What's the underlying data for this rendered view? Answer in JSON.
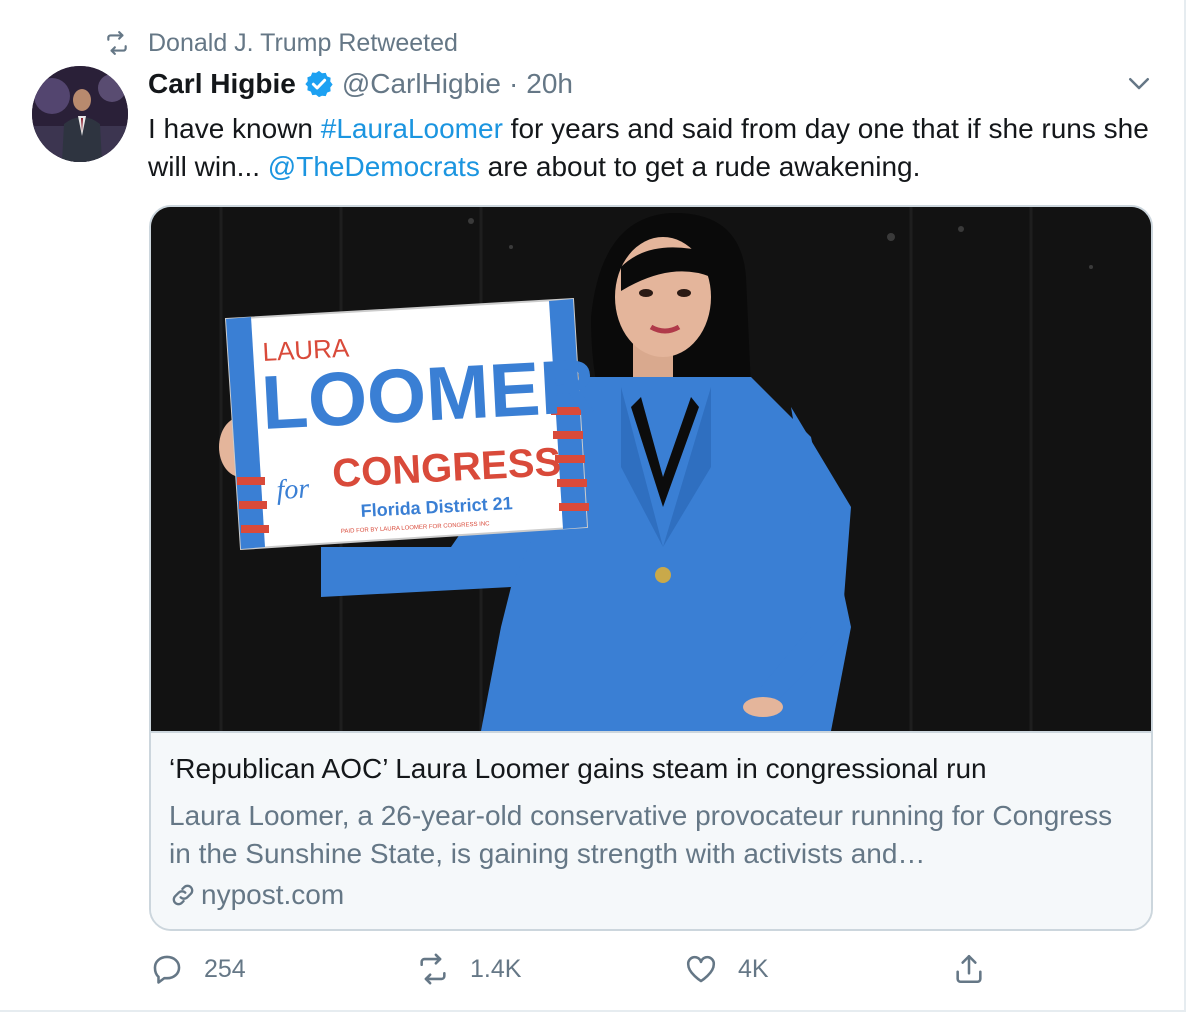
{
  "retweet_context": {
    "text": "Donald J. Trump Retweeted",
    "icon": "retweet-icon"
  },
  "author": {
    "display_name": "Carl Higbie",
    "verified": true,
    "handle": "@CarlHigbie",
    "separator": "·",
    "time": "20h"
  },
  "tweet": {
    "text_parts": [
      {
        "text": "I have known ",
        "type": "text"
      },
      {
        "text": "#LauraLoomer",
        "type": "hashtag"
      },
      {
        "text": " for years and said from day one that if she runs she will win...  ",
        "type": "text"
      },
      {
        "text": "@TheDemocrats",
        "type": "mention"
      },
      {
        "text": " are about to get a rude awakening.",
        "type": "text"
      }
    ]
  },
  "card": {
    "image": {
      "sign_top": "LAURA",
      "sign_name": "LOOMER",
      "sign_for": "for",
      "sign_congress": "CONGRESS",
      "sign_district": "Florida District 21",
      "sign_fine_print": "PAID FOR BY LAURA LOOMER FOR CONGRESS INC"
    },
    "title": "‘Republican AOC’ Laura Loomer gains steam in congressional run",
    "description": "Laura Loomer, a 26-year-old conservative provocateur running for Congress in the Sunshine State, is gaining strength with activists and…",
    "domain": "nypost.com"
  },
  "actions": {
    "reply_count": "254",
    "retweet_count": "1.4K",
    "like_count": "4K"
  },
  "colors": {
    "link": "#1b95e0",
    "secondary_text": "#657786",
    "border": "#ccd6dd",
    "verified": "#1da1f2",
    "blazer": "#3a7fd4"
  }
}
